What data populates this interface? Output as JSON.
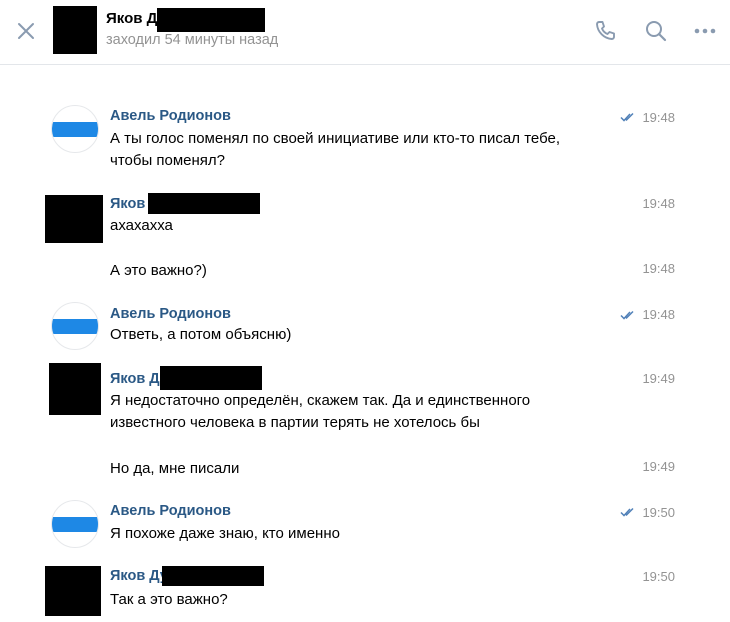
{
  "header": {
    "name": "Яков Д",
    "status": "заходил 54 минуты назад"
  },
  "messages": [
    {
      "author": "Авель Родионов",
      "time": "19:48",
      "lines": [
        "А ты голос поменял по своей инициативе или кто-то писал тебе,",
        "чтобы поменял?"
      ]
    },
    {
      "author": "Яков",
      "time": "19:48",
      "lines": [
        "ахахахха"
      ]
    },
    {
      "time": "19:48",
      "lines": [
        "А это важно?)"
      ]
    },
    {
      "author": "Авель Родионов",
      "time": "19:48",
      "lines": [
        "Ответь, а потом объясню)"
      ]
    },
    {
      "author": "Яков Д",
      "time": "19:49",
      "lines": [
        "Я недостаточно определён, скажем так. Да и единственного",
        "известного человека в партии терять не хотелось бы"
      ]
    },
    {
      "time": "19:49",
      "lines": [
        "Но да, мне писали"
      ]
    },
    {
      "author": "Авель Родионов",
      "time": "19:50",
      "lines": [
        "Я похоже даже знаю, кто именно"
      ]
    },
    {
      "author": "Яков Ду",
      "time": "19:50",
      "lines": [
        "Так а это важно?"
      ]
    }
  ],
  "colors": {
    "author": "#2a5885",
    "muted": "#939393",
    "icon": "#8a9bb0",
    "check": "#5181b8",
    "avatar_stripe": "#1e88e5"
  },
  "icons": [
    "close-icon",
    "phone-icon",
    "search-icon",
    "more-icon",
    "read-check-icon"
  ]
}
